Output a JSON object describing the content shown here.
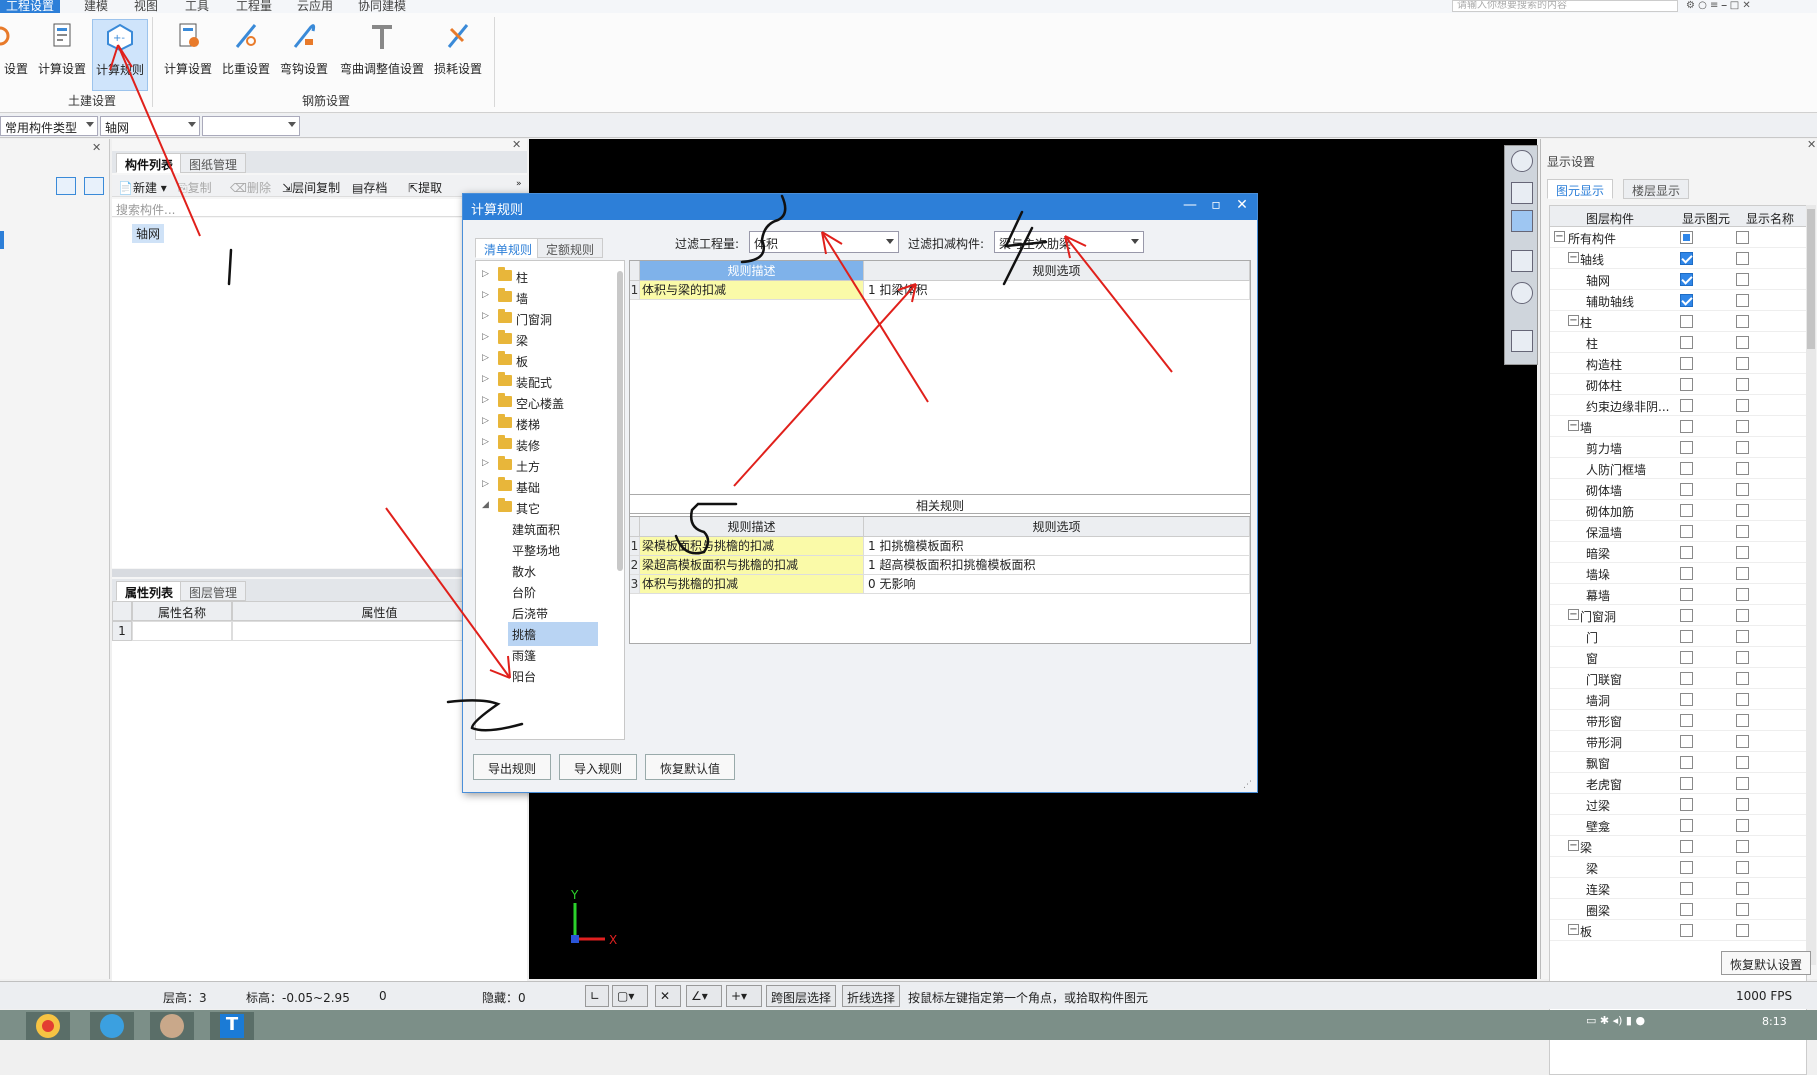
{
  "menubar": {
    "items": [
      "工程设置",
      "建模",
      "视图",
      "工具",
      "工程量",
      "云应用",
      "协同建模"
    ],
    "search_placeholder": "请输入你想要搜索的内容"
  },
  "ribbon": {
    "civil_buttons": [
      "设置",
      "计算设置",
      "计算规则"
    ],
    "rebar_buttons": [
      "计算设置",
      "比重设置",
      "弯钩设置",
      "弯曲调整值设置",
      "损耗设置"
    ],
    "civil_group_label": "土建设置",
    "rebar_group_label": "钢筋设置"
  },
  "toolbar2": {
    "component_type": "常用构件类型",
    "component": "轴网",
    "third": ""
  },
  "left_panel": {
    "tabs": [
      "构件列表",
      "图纸管理"
    ],
    "tools": [
      "新建",
      "复制",
      "删除",
      "层间复制",
      "存档",
      "提取"
    ],
    "search_placeholder": "搜索构件...",
    "selected_item": "轴网",
    "prop_tabs": [
      "属性列表",
      "图层管理"
    ],
    "prop_headers": [
      "属性名称",
      "属性值"
    ],
    "prop_row_num": "1"
  },
  "dialog": {
    "title": "计算规则",
    "tabs": [
      "清单规则",
      "定额规则"
    ],
    "filter_quantity_label": "过滤工程量:",
    "filter_quantity_value": "体积",
    "filter_deduct_label": "过滤扣减构件:",
    "filter_deduct_value": "梁与主次肋梁",
    "tree_items": [
      "柱",
      "墙",
      "门窗洞",
      "梁",
      "板",
      "装配式",
      "空心楼盖",
      "楼梯",
      "装修",
      "土方",
      "基础",
      "其它"
    ],
    "tree_children": [
      "建筑面积",
      "平整场地",
      "散水",
      "台阶",
      "后浇带",
      "挑檐",
      "雨篷",
      "阳台"
    ],
    "selected_child": "挑檐",
    "main_headers": [
      "规则描述",
      "规则选项"
    ],
    "main_rows": [
      {
        "n": "1",
        "desc": "体积与梁的扣减",
        "opt": "1  扣梁体积"
      }
    ],
    "related_title": "相关规则",
    "related_headers": [
      "规则描述",
      "规则选项"
    ],
    "related_rows": [
      {
        "n": "1",
        "desc": "梁模板面积与挑檐的扣减",
        "opt": "1  扣挑檐模板面积"
      },
      {
        "n": "2",
        "desc": "梁超高模板面积与挑檐的扣减",
        "opt": "1  超高模板面积扣挑檐模板面积"
      },
      {
        "n": "3",
        "desc": "体积与挑檐的扣减",
        "opt": "0   无影响"
      }
    ],
    "buttons": [
      "导出规则",
      "导入规则",
      "恢复默认值"
    ]
  },
  "right_panel": {
    "title": "显示设置",
    "tabs": [
      "图元显示",
      "楼层显示"
    ],
    "headers": [
      "图层构件",
      "显示图元",
      "显示名称"
    ],
    "rows": [
      {
        "name": "所有构件",
        "level": 0,
        "expander": "−",
        "show": "part",
        "label": false
      },
      {
        "name": "轴线",
        "level": 1,
        "expander": "−",
        "show": "on",
        "label": false
      },
      {
        "name": "轴网",
        "level": 2,
        "show": "on",
        "label": false
      },
      {
        "name": "辅助轴线",
        "level": 2,
        "show": "on",
        "label": false
      },
      {
        "name": "柱",
        "level": 1,
        "expander": "−",
        "show": "off",
        "label": false
      },
      {
        "name": "柱",
        "level": 2,
        "show": "off",
        "label": false
      },
      {
        "name": "构造柱",
        "level": 2,
        "show": "off",
        "label": false
      },
      {
        "name": "砌体柱",
        "level": 2,
        "show": "off",
        "label": false
      },
      {
        "name": "约束边缘非阴...",
        "level": 2,
        "show": "off",
        "label": false
      },
      {
        "name": "墙",
        "level": 1,
        "expander": "−",
        "show": "off",
        "label": false
      },
      {
        "name": "剪力墙",
        "level": 2,
        "show": "off",
        "label": false
      },
      {
        "name": "人防门框墙",
        "level": 2,
        "show": "off",
        "label": false
      },
      {
        "name": "砌体墙",
        "level": 2,
        "show": "off",
        "label": false
      },
      {
        "name": "砌体加筋",
        "level": 2,
        "show": "off",
        "label": false
      },
      {
        "name": "保温墙",
        "level": 2,
        "show": "off",
        "label": false
      },
      {
        "name": "暗梁",
        "level": 2,
        "show": "off",
        "label": false
      },
      {
        "name": "墙垛",
        "level": 2,
        "show": "off",
        "label": false
      },
      {
        "name": "幕墙",
        "level": 2,
        "show": "off",
        "label": false
      },
      {
        "name": "门窗洞",
        "level": 1,
        "expander": "−",
        "show": "off",
        "label": false
      },
      {
        "name": "门",
        "level": 2,
        "show": "off",
        "label": false
      },
      {
        "name": "窗",
        "level": 2,
        "show": "off",
        "label": false
      },
      {
        "name": "门联窗",
        "level": 2,
        "show": "off",
        "label": false
      },
      {
        "name": "墙洞",
        "level": 2,
        "show": "off",
        "label": false
      },
      {
        "name": "带形窗",
        "level": 2,
        "show": "off",
        "label": false
      },
      {
        "name": "带形洞",
        "level": 2,
        "show": "off",
        "label": false
      },
      {
        "name": "飘窗",
        "level": 2,
        "show": "off",
        "label": false
      },
      {
        "name": "老虎窗",
        "level": 2,
        "show": "off",
        "label": false
      },
      {
        "name": "过梁",
        "level": 2,
        "show": "off",
        "label": false
      },
      {
        "name": "壁龛",
        "level": 2,
        "show": "off",
        "label": false
      },
      {
        "name": "梁",
        "level": 1,
        "expander": "−",
        "show": "off",
        "label": false
      },
      {
        "name": "梁",
        "level": 2,
        "show": "off",
        "label": false
      },
      {
        "name": "连梁",
        "level": 2,
        "show": "off",
        "label": false
      },
      {
        "name": "圈梁",
        "level": 2,
        "show": "off",
        "label": false
      },
      {
        "name": "板",
        "level": 1,
        "expander": "−",
        "show": "off",
        "label": false
      }
    ],
    "restore_button": "恢复默认设置"
  },
  "statusbar": {
    "floor": "层高：3",
    "elevation": "标高：-0.05~2.95",
    "zero": "0",
    "hidden": "隐藏：0",
    "cross_layer": "跨图层选择",
    "polyline": "折线选择",
    "hint": "按鼠标左键指定第一个角点，或拾取构件图元",
    "fps": "1000 FPS"
  },
  "taskbar": {
    "time": "8:13"
  },
  "annotations": {
    "colors": {
      "red": "#e0201b",
      "black": "#111111",
      "accent": "#2d7fd8",
      "highlight": "#fafaa8"
    }
  }
}
